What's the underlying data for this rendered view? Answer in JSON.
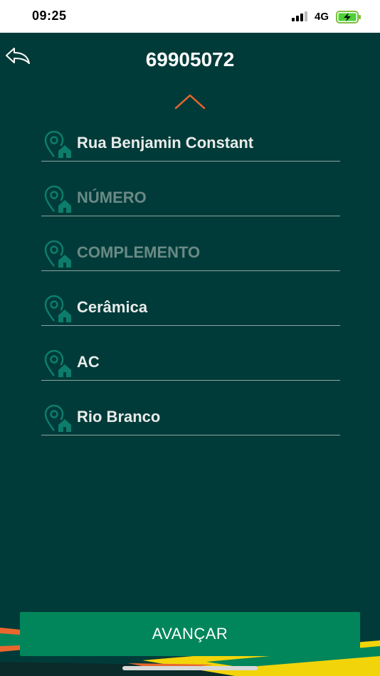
{
  "status_bar": {
    "time": "09:25",
    "network": "4G"
  },
  "header": {
    "title": "69905072"
  },
  "fields": [
    {
      "name": "street",
      "text": "Rua Benjamin Constant",
      "is_placeholder": false
    },
    {
      "name": "number",
      "text": "NÚMERO",
      "is_placeholder": true
    },
    {
      "name": "complement",
      "text": "COMPLEMENTO",
      "is_placeholder": true
    },
    {
      "name": "neighborhood",
      "text": "Cerâmica",
      "is_placeholder": false
    },
    {
      "name": "state",
      "text": "AC",
      "is_placeholder": false
    },
    {
      "name": "city",
      "text": "Rio Branco",
      "is_placeholder": false
    }
  ],
  "actions": {
    "advance_label": "AVANÇAR"
  },
  "colors": {
    "background": "#003b39",
    "accent_orange": "#e8672e",
    "button_green": "#00865a",
    "icon_teal": "#0e7c6a"
  }
}
